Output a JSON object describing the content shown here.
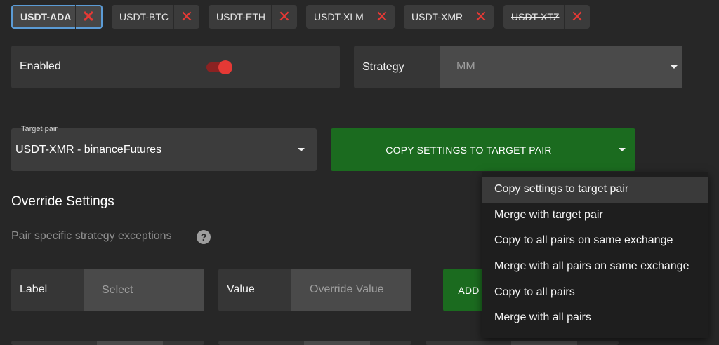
{
  "tabs": [
    {
      "label": "USDT-ADA",
      "selected": true
    },
    {
      "label": "USDT-BTC"
    },
    {
      "label": "USDT-ETH"
    },
    {
      "label": "USDT-XLM"
    },
    {
      "label": "USDT-XMR"
    },
    {
      "label": "USDT-XTZ",
      "struck": true
    }
  ],
  "close_glyph": "✕",
  "enabled": {
    "label": "Enabled",
    "on": true
  },
  "strategy": {
    "label": "Strategy",
    "value": "MM"
  },
  "target_pair": {
    "floating_label": "Target pair",
    "value": "USDT-XMR - binanceFutures"
  },
  "copy_button": {
    "label": "COPY SETTINGS TO TARGET PAIR"
  },
  "copy_menu": {
    "items": [
      "Copy settings to target pair",
      "Merge with target pair",
      "Copy to all pairs on same exchange",
      "Merge with all pairs on same exchange",
      "Copy to all pairs",
      "Merge with all pairs"
    ]
  },
  "override": {
    "title": "Override Settings",
    "subtitle": "Pair specific strategy exceptions",
    "help_glyph": "?",
    "label_field": {
      "label": "Label",
      "placeholder": "Select"
    },
    "value_field": {
      "label": "Value",
      "placeholder": "Override Value"
    },
    "add_button": "ADD"
  },
  "colors": {
    "background": "#272727",
    "accent_green": "#1b6b1f",
    "close_red": "#e53935",
    "selected_border": "#5b9bd5"
  }
}
